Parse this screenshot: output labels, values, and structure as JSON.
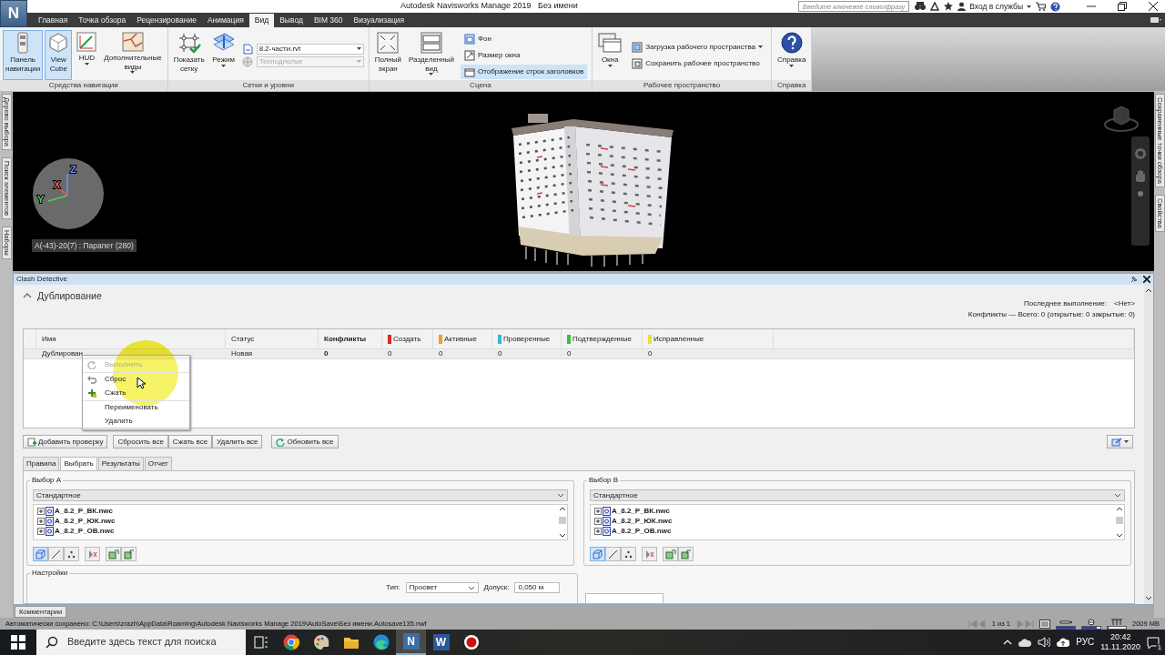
{
  "app_button": {
    "letter": "N"
  },
  "window": {
    "title": "Autodesk Navisworks Manage 2019",
    "document": "Без имени"
  },
  "search": {
    "placeholder": "Введите ключевое слово/фразу"
  },
  "sign_in": {
    "label": "Вход в службы"
  },
  "ribbon_tabs": [
    {
      "label": "Главная",
      "selected": false
    },
    {
      "label": "Точка обзора",
      "selected": false
    },
    {
      "label": "Рецензирование",
      "selected": false
    },
    {
      "label": "Анимация",
      "selected": false
    },
    {
      "label": "Вид",
      "selected": true
    },
    {
      "label": "Вывод",
      "selected": false
    },
    {
      "label": "BIM 360",
      "selected": false
    },
    {
      "label": "Визуализация",
      "selected": false
    }
  ],
  "ribbon_groups": [
    {
      "title": "Средства навигации",
      "items": [
        {
          "kind": "large",
          "label": "Панель навигации",
          "on": true,
          "has_menu": false
        },
        {
          "kind": "large",
          "label": "View Cube",
          "on": true,
          "has_menu": false
        },
        {
          "kind": "large",
          "label": "HUD",
          "on": false,
          "has_menu": true
        },
        {
          "kind": "large",
          "label": "Дополнительные виды",
          "on": false,
          "has_menu": true
        }
      ]
    },
    {
      "title": "Сетки и уровни",
      "items": [
        {
          "kind": "large",
          "label": "Показать сетку",
          "on": false,
          "has_menu": false
        },
        {
          "kind": "large",
          "label": "Режим",
          "on": false,
          "has_menu": true
        },
        {
          "kind": "combo",
          "value": "8.2-части.rvt",
          "disabled": false
        },
        {
          "kind": "combo",
          "value": "Техподполье",
          "disabled": true
        }
      ]
    },
    {
      "title": "Сцена",
      "items": [
        {
          "kind": "large",
          "label": "Полный экран",
          "on": false,
          "has_menu": false
        },
        {
          "kind": "large",
          "label": "Разделенный вид",
          "on": false,
          "has_menu": true
        },
        {
          "kind": "small",
          "label": "Фон",
          "on": false,
          "has_menu": false
        },
        {
          "kind": "small",
          "label": "Размер окна",
          "on": false,
          "has_menu": false
        },
        {
          "kind": "small",
          "label": "Отображение строк заголовков",
          "on": true,
          "has_menu": false
        }
      ]
    },
    {
      "title": "Рабочее пространство",
      "items": [
        {
          "kind": "large",
          "label": "Окна",
          "on": false,
          "has_menu": true
        },
        {
          "kind": "small",
          "label": "Загрузка рабочего пространства",
          "on": false,
          "has_menu": true
        },
        {
          "kind": "small",
          "label": "Сохранить рабочее пространство",
          "on": false,
          "has_menu": false
        }
      ]
    },
    {
      "title": "Справка",
      "items": [
        {
          "kind": "large",
          "label": "Справка",
          "on": false,
          "has_menu": true
        }
      ]
    }
  ],
  "side_tabs_left": [
    "Дерево выбора",
    "Поиск элементов",
    "Наборы"
  ],
  "side_tabs_right": [
    "Сохраненные точки обзора",
    "Свойства"
  ],
  "viewport": {
    "hover_label": "A(-43)-20(7) : Парапет (280)",
    "axes": [
      {
        "label": "Z",
        "color": "#6f8cff"
      },
      {
        "label": "Y",
        "color": "#4fd05a"
      },
      {
        "label": "X",
        "color": "#ff5a4a"
      }
    ]
  },
  "clash": {
    "title": "Clash Detective",
    "test_name": "Дублирование",
    "expanded": true,
    "last_run_label": "Последнее выполнение:",
    "last_run_value": "<Нет>",
    "summary": "Конфликты — Всего: 0 (открытые: 0 закрытые: 0)",
    "columns": [
      {
        "label": "Имя",
        "bold": false
      },
      {
        "label": "Статус",
        "bold": false
      },
      {
        "label": "Конфликты",
        "bold": true
      },
      {
        "label": "Создать",
        "bold": false,
        "color": "#e02424"
      },
      {
        "label": "Активные",
        "bold": false,
        "color": "#f0a020"
      },
      {
        "label": "Проверенные",
        "bold": false,
        "color": "#35b8e0"
      },
      {
        "label": "Подтвержденные",
        "bold": false,
        "color": "#33c23a"
      },
      {
        "label": "Исправленные",
        "bold": false,
        "color": "#e8e030"
      }
    ],
    "rows": [
      {
        "selected": true,
        "cells": [
          "Дублирован",
          "Новая",
          "0",
          "0",
          "0",
          "0",
          "0",
          "0"
        ]
      }
    ],
    "context_menu": [
      {
        "label": "Выполнить",
        "disabled": true,
        "separator_before": false
      },
      {
        "label": "Сброс",
        "disabled": false,
        "separator_before": true
      },
      {
        "label": "Сжать",
        "disabled": false,
        "separator_before": false
      },
      {
        "label": "Переименовать",
        "disabled": false,
        "separator_before": true
      },
      {
        "label": "Удалить",
        "disabled": false,
        "separator_before": false
      }
    ],
    "button_groups": [
      [
        {
          "label": "Добавить проверку"
        }
      ],
      [
        {
          "label": "Сбросить все"
        },
        {
          "label": "Сжать все"
        },
        {
          "label": "Удалить все"
        }
      ],
      [
        {
          "label": "Обновить все"
        }
      ]
    ],
    "tabs": [
      {
        "label": "Правила",
        "selected": false
      },
      {
        "label": "Выбрать",
        "selected": true
      },
      {
        "label": "Результаты",
        "selected": false
      },
      {
        "label": "Отчет",
        "selected": false
      }
    ],
    "selections": [
      {
        "title": "Выбор А",
        "mode": "Стандартное",
        "items": [
          "А_8.2_Р_ВК.nwc",
          "А_8.2_Р_ЮК.nwc",
          "А_8.2_Р_ОВ.nwc"
        ],
        "tools": [
          {
            "selected": true
          },
          {
            "selected": false
          },
          {
            "selected": false
          },
          {
            "selected": false
          },
          {
            "selected": false
          },
          {
            "selected": false
          }
        ]
      },
      {
        "title": "Выбор В",
        "mode": "Стандартное",
        "items": [
          "А_8.2_Р_ВК.nwc",
          "А_8.2_Р_ЮК.nwc",
          "А_8.2_Р_ОВ.nwc"
        ],
        "tools": [
          {
            "selected": true
          },
          {
            "selected": false
          },
          {
            "selected": false
          },
          {
            "selected": false
          },
          {
            "selected": false
          },
          {
            "selected": false
          }
        ]
      }
    ],
    "settings": {
      "title": "Настройки",
      "type_label": "Тип:",
      "type_value": "Просвет",
      "tolerance_label": "Допуск:",
      "tolerance_value": "0,050 м"
    }
  },
  "comments_tab": "Комментарии",
  "status_bar": {
    "message": "Автоматически сохранено: C:\\Users\\zrazh\\AppData\\Roaming\\Autodesk Navisworks Manage 2019\\AutoSave\\Без имени.Autosave135.nwf",
    "page": "1 из 1",
    "memory": "2009 MB",
    "meters": [
      {
        "level": 1
      },
      {
        "level": 0.8
      },
      {
        "level": 0
      }
    ]
  },
  "taskbar": {
    "search_placeholder": "Введите здесь текст для поиска",
    "apps": [
      {
        "kind": "taskview",
        "selected": false
      },
      {
        "kind": "chrome",
        "selected": false
      },
      {
        "kind": "paint",
        "selected": false
      },
      {
        "kind": "explorer",
        "selected": false
      },
      {
        "kind": "edge",
        "selected": false
      },
      {
        "kind": "navisworks",
        "letter": "N",
        "selected": true
      },
      {
        "kind": "word",
        "letter": "W",
        "selected": false
      },
      {
        "kind": "record",
        "selected": false
      }
    ],
    "language": "РУС",
    "time": "20:42",
    "date": "11.11.2020",
    "notifications": "1"
  }
}
